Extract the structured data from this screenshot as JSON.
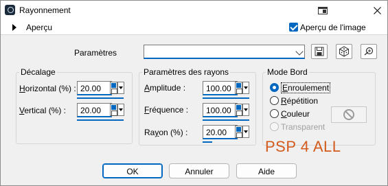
{
  "window": {
    "title": "Rayonnement"
  },
  "preview_bar": {
    "toggle_label": "Aperçu",
    "image_preview_label": "Aperçu de l'image",
    "image_preview_checked": true
  },
  "presets": {
    "label": "Paramètres",
    "value": ""
  },
  "offset_group": {
    "title": "Décalage",
    "horizontal": {
      "label_key": "H",
      "label_rest": "orizontal (%) :",
      "value": "20.00"
    },
    "vertical": {
      "label_key": "V",
      "label_rest": "ertical (%) :",
      "value": "20.00"
    }
  },
  "rays_group": {
    "title": "Paramètres des rayons",
    "amplitude": {
      "label_key": "A",
      "label_rest": "mplitude :",
      "value": "100.00"
    },
    "frequency": {
      "label_key": "F",
      "label_rest": "réquence :",
      "value": "100.00"
    },
    "radius": {
      "label_pre": "Ra",
      "label_key": "y",
      "label_rest": "on (%) :",
      "value": "20.00"
    }
  },
  "edge_group": {
    "title": "Mode Bord",
    "options": [
      {
        "label_key": "E",
        "label_rest": "nroulement",
        "selected": true,
        "disabled": false
      },
      {
        "label_key": "R",
        "label_rest": "épétition",
        "selected": false,
        "disabled": false
      },
      {
        "label_key": "C",
        "label_rest": "ouleur",
        "selected": false,
        "disabled": false
      },
      {
        "label_key": "T",
        "label_rest": "ransparent",
        "selected": false,
        "disabled": true
      }
    ]
  },
  "watermark": "PSP 4 ALL",
  "buttons": {
    "ok": "OK",
    "cancel": "Annuler",
    "help": "Aide"
  },
  "colors": {
    "accent": "#0067c0",
    "watermark": "#d25a1c",
    "panel": "#f0f0f0"
  },
  "icons": {
    "title_bar": [
      "app-icon",
      "restore-preview-icon",
      "close-icon"
    ],
    "toolbar": [
      "save-preset-icon",
      "randomize-dice-icon",
      "reset-icon"
    ],
    "color_swatch": "no-color-icon"
  }
}
